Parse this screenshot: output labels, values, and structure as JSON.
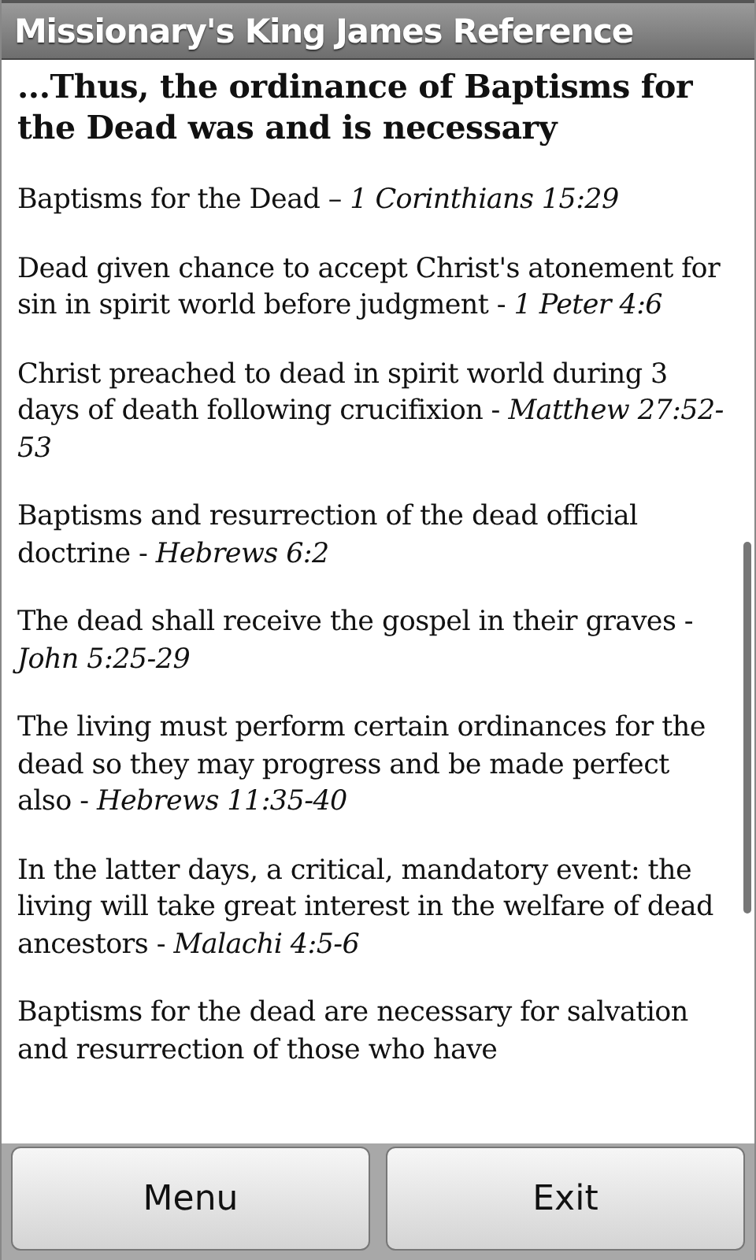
{
  "window": {
    "title": "Missionary's King James Reference"
  },
  "heading": "...Thus, the ordinance of Baptisms for the Dead was and is necessary",
  "entries": [
    "Baptisms for the Dead – *1 Corinthians 15:29*",
    "Dead given chance to accept Christ's atonement for sin in spirit world before judgment - *1 Peter 4:6*",
    "Christ preached to dead in spirit world during 3 days of death following crucifixion - *Matthew 27:52-53*",
    "Baptisms and resurrection of the dead official doctrine - *Hebrews 6:2*",
    "The dead shall receive the gospel in their graves - *John 5:25-29*",
    "The living must perform certain ordinances for the dead so they may progress and be made perfect also - *Hebrews 11:35-40*",
    "In the latter days, a critical, mandatory event: the living will take great interest in the welfare of dead ancestors - *Malachi 4:5-6*",
    "Baptisms for the dead are necessary for salvation and resurrection of those who have"
  ],
  "buttons": [
    "Menu",
    "Exit"
  ]
}
